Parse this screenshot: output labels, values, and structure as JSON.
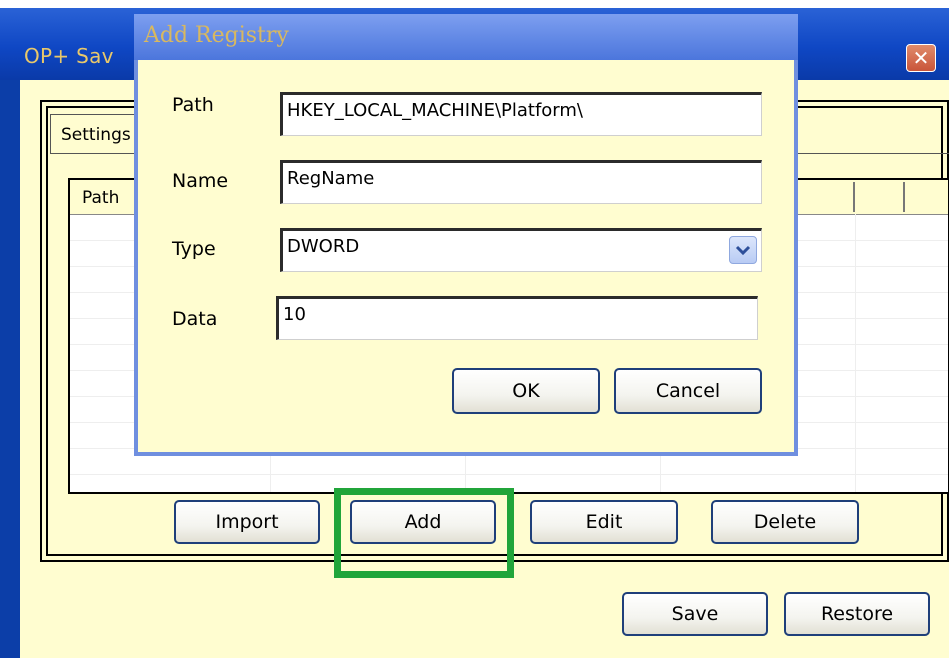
{
  "main_window": {
    "title": "OP+ Sav",
    "close_glyph": "✕"
  },
  "tab": {
    "label": "Settings"
  },
  "list": {
    "columns": [
      "Path"
    ]
  },
  "actions": {
    "import_label": "Import",
    "add_label": "Add",
    "edit_label": "Edit",
    "delete_label": "Delete",
    "save_label": "Save",
    "restore_label": "Restore"
  },
  "dialog": {
    "title": "Add Registry",
    "fields": {
      "path": {
        "label": "Path",
        "value": "HKEY_LOCAL_MACHINE\\Platform\\"
      },
      "name": {
        "label": "Name",
        "value": "RegName"
      },
      "type": {
        "label": "Type",
        "value": "DWORD"
      },
      "data": {
        "label": "Data",
        "value": "10"
      }
    },
    "ok_label": "OK",
    "cancel_label": "Cancel"
  },
  "colors": {
    "titlebar_blue": "#0f47c4",
    "dialog_titlebar": "#5f86e4",
    "window_bg": "#fffdd0",
    "highlight": "#21a53a",
    "title_text": "#e9c86a"
  },
  "icons": {
    "close": "close-icon",
    "dropdown": "chevron-down-icon"
  }
}
